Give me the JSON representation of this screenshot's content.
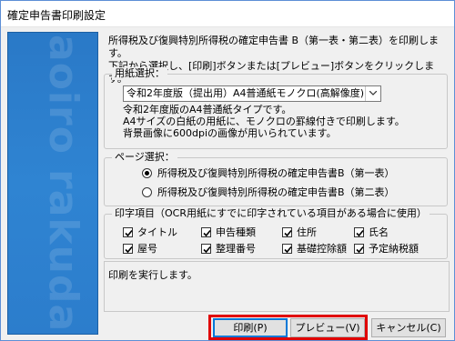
{
  "window": {
    "title": "確定申告書印刷設定"
  },
  "sidebar": {
    "brand_top": "aoiro",
    "brand_bottom": "rakuda"
  },
  "description": {
    "line1": "所得税及び復興特別所得税の確定申告書 B（第一表・第二表）を印刷します。",
    "line2": "下記から選択し、[印刷]ボタンまたは[プレビュー]ボタンをクリックします。"
  },
  "paper": {
    "group_label": "用紙選択：",
    "selected": "令和2年度版（提出用）A4普通紙モノクロ(高解像度)",
    "info1": "令和2年度版のA4普通紙タイプです。",
    "info2": "A4サイズの白紙の用紙に、モノクロの罫線付きで印刷します。",
    "info3": "背景画像に600dpiの画像が用いられています。"
  },
  "page": {
    "group_label": "ページ選択：",
    "options": [
      {
        "label": "所得税及び復興特別所得税の確定申告書B（第一表）",
        "selected": true
      },
      {
        "label": "所得税及び復興特別所得税の確定申告書B（第二表）",
        "selected": false
      }
    ]
  },
  "items": {
    "group_label": "印字項目（OCR用紙にすでに印字されている項目がある場合に使用）",
    "checkboxes": [
      {
        "label": "タイトル",
        "checked": true
      },
      {
        "label": "申告種類",
        "checked": true
      },
      {
        "label": "住所",
        "checked": true
      },
      {
        "label": "氏名",
        "checked": true
      },
      {
        "label": "屋号",
        "checked": true
      },
      {
        "label": "整理番号",
        "checked": true
      },
      {
        "label": "基礎控除額",
        "checked": true
      },
      {
        "label": "予定納税額",
        "checked": true
      }
    ]
  },
  "status": {
    "text": "印刷を実行します。"
  },
  "buttons": {
    "print": "印刷(P)",
    "preview": "プレビュー(V)",
    "cancel": "キャンセル(C)"
  },
  "colors": {
    "sidebar": "#2c7dcc",
    "highlight": "#e00000",
    "focus": "#0078d7"
  }
}
